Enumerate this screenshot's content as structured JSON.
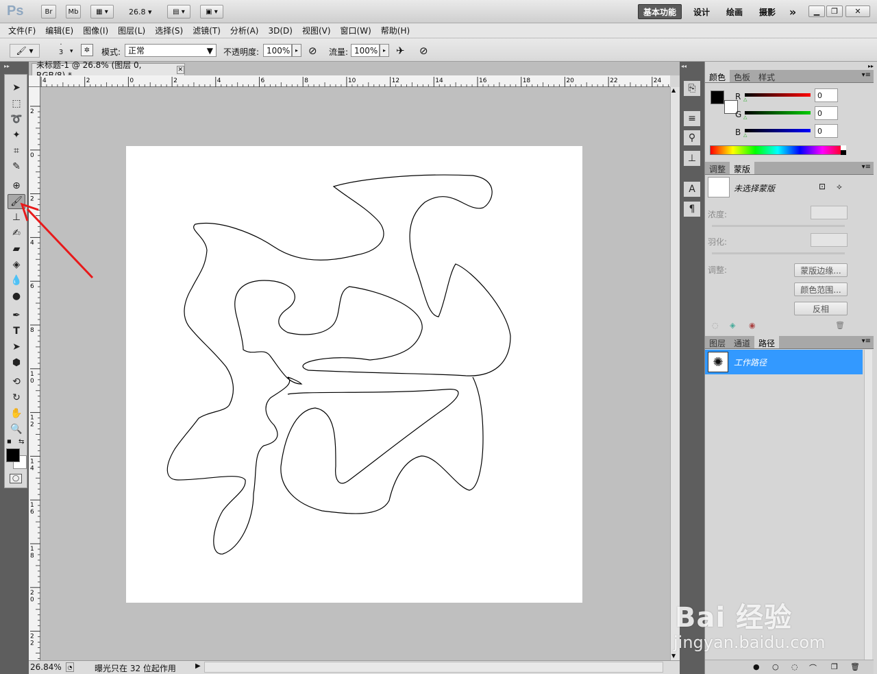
{
  "app": {
    "logo": "Ps",
    "zoom_select": "26.8"
  },
  "titlebar": {
    "br": "Br",
    "mb": "Mb",
    "workspaces": [
      "基本功能",
      "设计",
      "绘画",
      "摄影"
    ],
    "more": "»"
  },
  "menu": [
    "文件(F)",
    "编辑(E)",
    "图像(I)",
    "图层(L)",
    "选择(S)",
    "滤镜(T)",
    "分析(A)",
    "3D(D)",
    "视图(V)",
    "窗口(W)",
    "帮助(H)"
  ],
  "options": {
    "brush_size": "3",
    "mode_label": "模式:",
    "mode_value": "正常",
    "opacity_label": "不透明度:",
    "opacity_value": "100%",
    "flow_label": "流量:",
    "flow_value": "100%"
  },
  "document": {
    "tab_title": "未标题-1 @ 26.8% (图层 0, RGB/8) *",
    "status_zoom": "26.84%",
    "status_text": "曝光只在 32 位起作用",
    "ruler_h_labels": [
      "4",
      "2",
      "0",
      "2",
      "4",
      "6",
      "8",
      "10",
      "12",
      "14",
      "16",
      "18",
      "20",
      "22",
      "24"
    ],
    "ruler_v_labels": [
      "2",
      "0",
      "2",
      "4",
      "6",
      "8",
      "1 0",
      "1 2",
      "1 4",
      "1 6",
      "1 8",
      "2 0",
      "2 2"
    ]
  },
  "color_panel": {
    "tabs": [
      "颜色",
      "色板",
      "样式"
    ],
    "r_label": "R",
    "r_value": "0",
    "g_label": "G",
    "g_value": "0",
    "b_label": "B",
    "b_value": "0"
  },
  "mask_panel": {
    "tabs": [
      "调整",
      "蒙版"
    ],
    "no_mask": "未选择蒙版",
    "density_label": "浓度:",
    "feather_label": "羽化:",
    "refine_label": "调整:",
    "btn_mask_edge": "蒙版边缘...",
    "btn_color_range": "颜色范围...",
    "btn_invert": "反相"
  },
  "layers_panel": {
    "tabs": [
      "图层",
      "通道",
      "路径"
    ],
    "path_name": "工作路径"
  },
  "watermark": {
    "brand": "Bai 经验",
    "url": "jingyan.baidu.com"
  },
  "colors": {
    "accent_selected": "#3399ff",
    "annotation_arrow": "#e8191a"
  }
}
